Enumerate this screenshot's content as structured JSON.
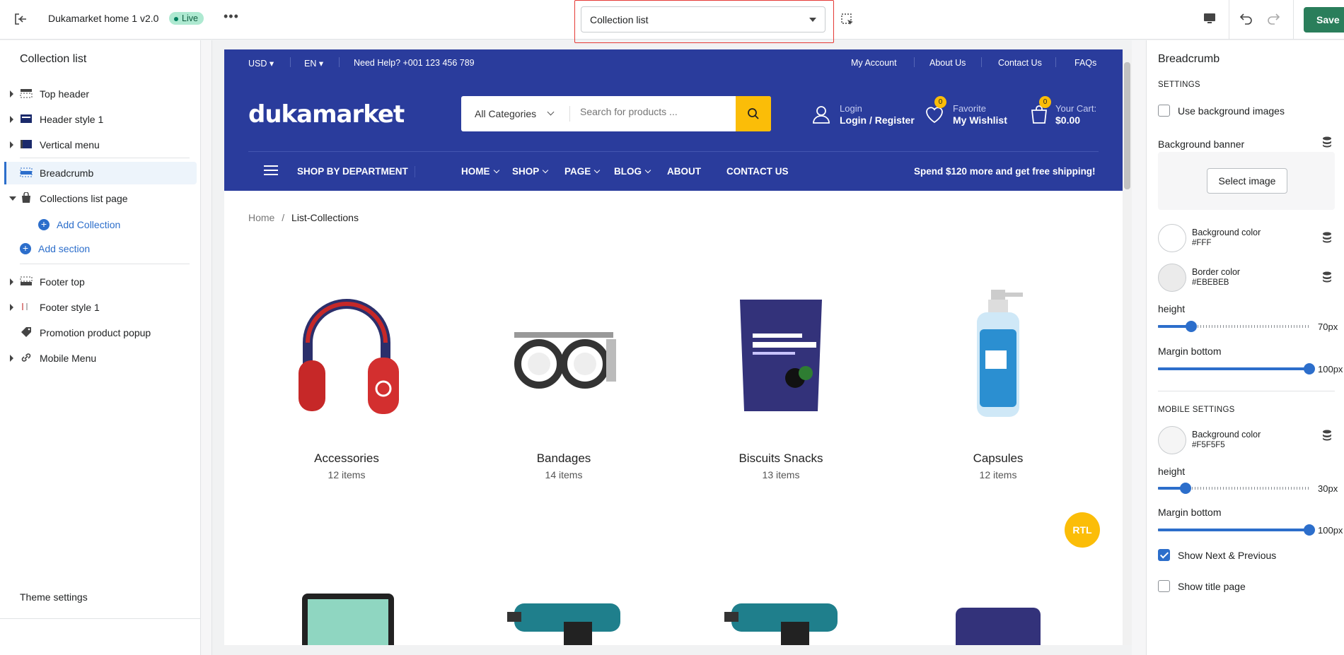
{
  "topbar": {
    "theme_name": "Dukamarket home 1 v2.0",
    "status": "Live",
    "more": "•••",
    "template_select": "Collection list",
    "save": "Save"
  },
  "sidebar": {
    "title": "Collection list",
    "items": [
      {
        "label": "Top header"
      },
      {
        "label": "Header style 1"
      },
      {
        "label": "Vertical menu"
      },
      {
        "label": "Breadcrumb"
      },
      {
        "label": "Collections list page"
      },
      {
        "label": "Add Collection"
      },
      {
        "label": "Add section"
      },
      {
        "label": "Footer top"
      },
      {
        "label": "Footer style 1"
      },
      {
        "label": "Promotion product popup"
      },
      {
        "label": "Mobile Menu"
      }
    ],
    "theme_settings": "Theme settings"
  },
  "store": {
    "topbar": {
      "currency": "USD",
      "language": "EN",
      "help": "Need Help? +001 123 456 789",
      "links": [
        "My Account",
        "About Us",
        "Contact Us",
        "FAQs"
      ]
    },
    "logo": "dukamarket",
    "search": {
      "category": "All Categories",
      "placeholder": "Search for products ..."
    },
    "account": {
      "small": "Login",
      "big": "Login / Register"
    },
    "wishlist": {
      "small": "Favorite",
      "big": "My Wishlist",
      "count": "0"
    },
    "cart": {
      "small": "Your Cart:",
      "big": "$0.00",
      "count": "0"
    },
    "nav": {
      "department": "SHOP BY DEPARTMENT",
      "items": [
        "HOME",
        "SHOP",
        "PAGE",
        "BLOG",
        "ABOUT",
        "CONTACT US"
      ],
      "promo": "Spend $120 more and get free shipping!"
    },
    "breadcrumb": {
      "home": "Home",
      "sep": "/",
      "current": "List-Collections"
    },
    "collections": [
      {
        "name": "Accessories",
        "count": "12 items",
        "icon": "headphones-image"
      },
      {
        "name": "Bandages",
        "count": "14 items",
        "icon": "trial-frame-image"
      },
      {
        "name": "Biscuits Snacks",
        "count": "13 items",
        "icon": "snack-bag-image"
      },
      {
        "name": "Capsules",
        "count": "12 items",
        "icon": "gel-bottle-image"
      }
    ],
    "rtl": "RTL"
  },
  "settings": {
    "title": "Breadcrumb",
    "section": "SETTINGS",
    "use_bg_images": "Use background images",
    "bg_banner": "Background banner",
    "select_image": "Select image",
    "bg_color": {
      "name": "Background color",
      "value": "#FFF"
    },
    "border_color": {
      "name": "Border color",
      "value": "#EBEBEB"
    },
    "height": {
      "label": "height",
      "value": "70px",
      "fraction": 0.22
    },
    "margin_bottom": {
      "label": "Margin bottom",
      "value": "100px",
      "fraction": 1.0
    },
    "mobile_section": "MOBILE SETTINGS",
    "mobile_bg_color": {
      "name": "Background color",
      "value": "#F5F5F5"
    },
    "mobile_height": {
      "label": "height",
      "value": "30px",
      "fraction": 0.18
    },
    "mobile_margin_bottom": {
      "label": "Margin bottom",
      "value": "100px",
      "fraction": 1.0
    },
    "show_next_prev": "Show Next & Previous",
    "show_title": "Show title page"
  },
  "colors": {
    "accent": "#2c6ecb",
    "save": "#2a7e5b",
    "store_blue": "#2a3c9c",
    "yellow": "#fbbd08"
  }
}
